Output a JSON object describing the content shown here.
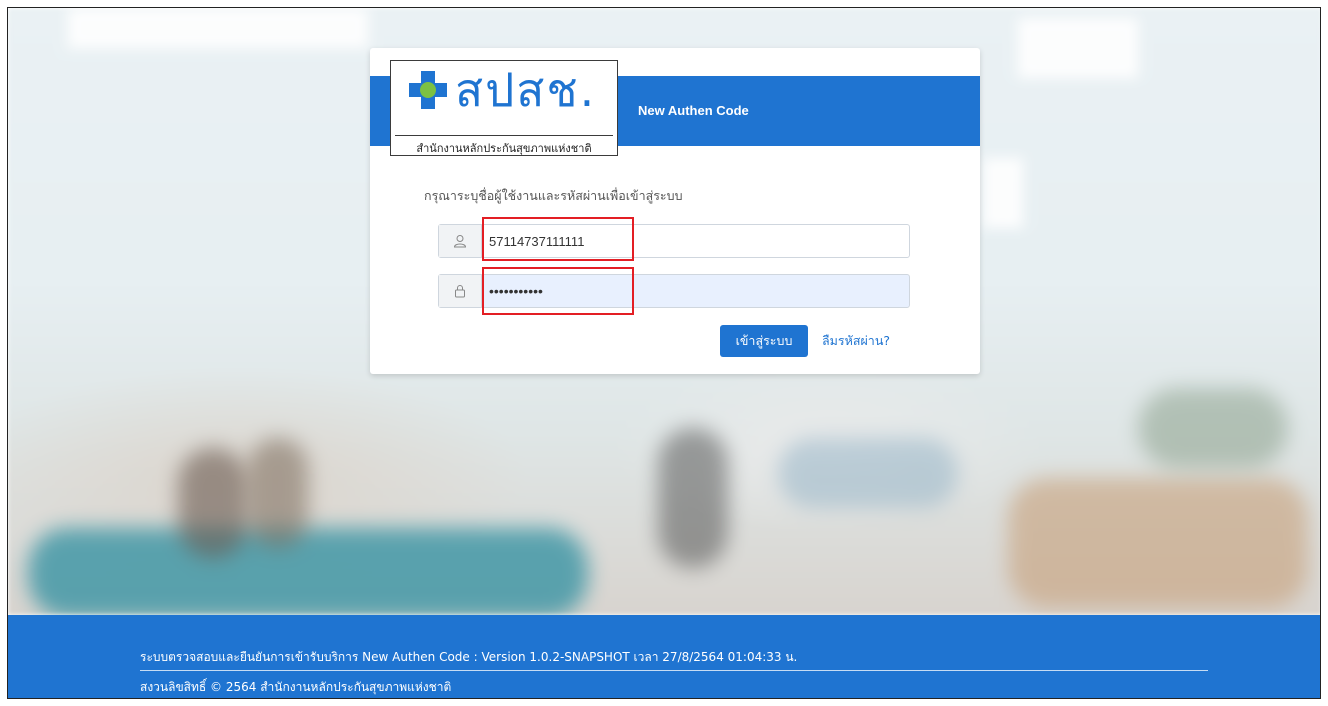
{
  "header": {
    "logo_text": "สปสช.",
    "logo_subtitle": "สำนักงานหลักประกันสุขภาพแห่งชาติ",
    "title": "New Authen Code"
  },
  "login": {
    "prompt": "กรุณาระบุชื่อผู้ใช้งานและรหัสผ่านเพื่อเข้าสู่ระบบ",
    "username_value": "57114737111111",
    "password_value": "•••••••••••",
    "username_icon": "user-icon",
    "password_icon": "lock-icon",
    "login_button": "เข้าสู่ระบบ",
    "forgot_link": "ลืมรหัสผ่าน?"
  },
  "footer": {
    "line1": "ระบบตรวจสอบและยืนยันการเข้ารับบริการ New Authen Code : Version 1.0.2-SNAPSHOT เวลา 27/8/2564 01:04:33 น.",
    "line2": "สงวนลิขสิทธิ์ © 2564 สำนักงานหลักประกันสุขภาพแห่งชาติ"
  },
  "colors": {
    "primary": "#1f74d1",
    "highlight": "#e31e24",
    "logo_green": "#7cc142"
  }
}
